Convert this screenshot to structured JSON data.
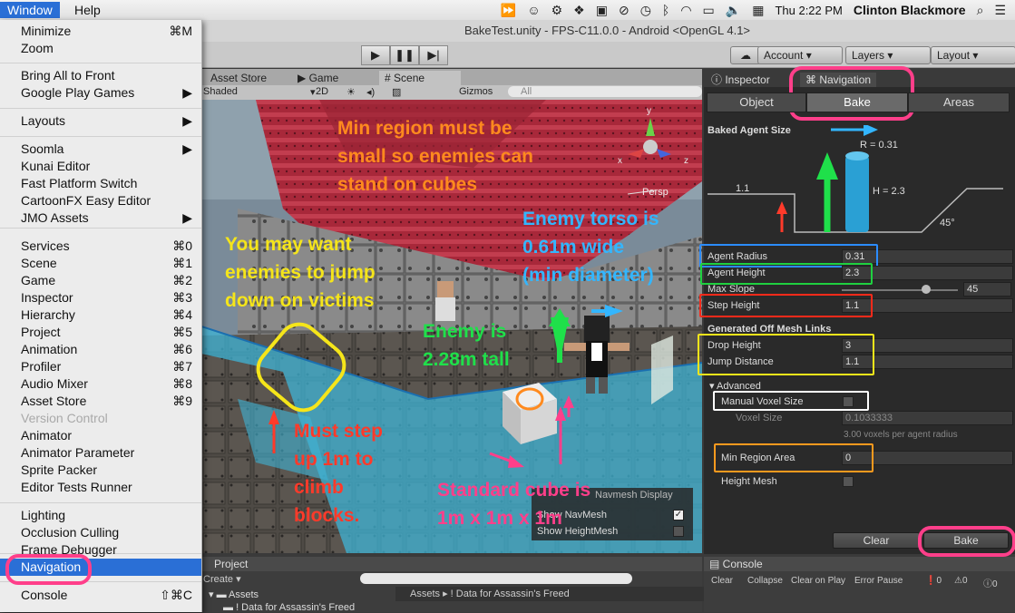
{
  "menubar": {
    "window_label": "Window",
    "help_label": "Help",
    "time": "Thu 2:22 PM",
    "user": "Clinton Blackmore"
  },
  "unity": {
    "title": "BakeTest.unity - FPS-C11.0.0 - Android <OpenGL 4.1>",
    "account": "Account",
    "layers": "Layers",
    "layout": "Layout"
  },
  "window_menu": [
    {
      "label": "Minimize",
      "shortcut": "⌘M"
    },
    {
      "label": "Zoom",
      "shortcut": ""
    },
    {
      "label": "Bring All to Front",
      "shortcut": ""
    },
    {
      "label": "Google Play Games",
      "shortcut": "▶"
    },
    {
      "label": "Layouts",
      "shortcut": "▶"
    },
    {
      "label": "Soomla",
      "shortcut": "▶"
    },
    {
      "label": "Kunai Editor",
      "shortcut": ""
    },
    {
      "label": "Fast Platform Switch",
      "shortcut": ""
    },
    {
      "label": "CartoonFX Easy Editor",
      "shortcut": ""
    },
    {
      "label": "JMO Assets",
      "shortcut": "▶"
    },
    {
      "label": "Services",
      "shortcut": "⌘0"
    },
    {
      "label": "Scene",
      "shortcut": "⌘1"
    },
    {
      "label": "Game",
      "shortcut": "⌘2"
    },
    {
      "label": "Inspector",
      "shortcut": "⌘3"
    },
    {
      "label": "Hierarchy",
      "shortcut": "⌘4"
    },
    {
      "label": "Project",
      "shortcut": "⌘5"
    },
    {
      "label": "Animation",
      "shortcut": "⌘6"
    },
    {
      "label": "Profiler",
      "shortcut": "⌘7"
    },
    {
      "label": "Audio Mixer",
      "shortcut": "⌘8"
    },
    {
      "label": "Asset Store",
      "shortcut": "⌘9"
    },
    {
      "label": "Version Control",
      "shortcut": ""
    },
    {
      "label": "Animator",
      "shortcut": ""
    },
    {
      "label": "Animator Parameter",
      "shortcut": ""
    },
    {
      "label": "Sprite Packer",
      "shortcut": ""
    },
    {
      "label": "Editor Tests Runner",
      "shortcut": ""
    },
    {
      "label": "Lighting",
      "shortcut": ""
    },
    {
      "label": "Occlusion Culling",
      "shortcut": ""
    },
    {
      "label": "Frame Debugger",
      "shortcut": ""
    },
    {
      "label": "Navigation",
      "shortcut": ""
    },
    {
      "label": "Console",
      "shortcut": "⇧⌘C"
    }
  ],
  "tabs": {
    "asset_store": "Asset Store",
    "game": "Game",
    "scene": "Scene",
    "shaded": "Shaded",
    "twod": "2D",
    "gizmos": "Gizmos",
    "search_placeholder": "All",
    "persp": "Persp",
    "project": "Project",
    "create": "Create",
    "assets": "Assets",
    "assets_path": "Assets ▸ ! Data for Assassin's Freed",
    "asset_folder": "! Data for Assassin's Freed",
    "console": "Console",
    "console_btns": [
      "Clear",
      "Collapse",
      "Clear on Play",
      "Error Pause"
    ],
    "console_counts": [
      "0",
      "0",
      "0"
    ]
  },
  "inspector": {
    "tab_inspector": "Inspector",
    "tab_navigation": "Navigation",
    "seg": [
      "Object",
      "Bake",
      "Areas"
    ],
    "baked_agent_size": "Baked Agent Size",
    "r_label": "R = 0.31",
    "h_label": "H = 2.3",
    "step_label": "1.1",
    "slope_label": "45°",
    "agent_radius": {
      "label": "Agent Radius",
      "value": "0.31"
    },
    "agent_height": {
      "label": "Agent Height",
      "value": "2.3"
    },
    "max_slope": {
      "label": "Max Slope",
      "value": "45",
      "level": 0.5
    },
    "step_height": {
      "label": "Step Height",
      "value": "1.1"
    },
    "off_mesh": "Generated Off Mesh Links",
    "drop_height": {
      "label": "Drop Height",
      "value": "3"
    },
    "jump_distance": {
      "label": "Jump Distance",
      "value": "1.1"
    },
    "advanced": "Advanced",
    "manual_voxel": "Manual Voxel Size",
    "voxel_size": {
      "label": "Voxel Size",
      "value": "0.1033333"
    },
    "voxel_note": "3.00 voxels per agent radius",
    "min_region": {
      "label": "Min Region Area",
      "value": "0"
    },
    "height_mesh": "Height Mesh",
    "clear": "Clear",
    "bake": "Bake"
  },
  "scene_overlay": {
    "show_navmesh": "Show NavMesh",
    "show_heightmesh": "Show HeightMesh",
    "nav_display": "Navmesh Display"
  },
  "annotations": {
    "min_region": "Min region must be\nsmall so enemies can\nstand on cubes",
    "jump": "You may want\nenemies to jump\ndown on victims",
    "torso": "Enemy torso is\n0.61m wide\n(min diameter)",
    "enemy_tall": "Enemy is\n2.28m tall",
    "step_up": "Must step\nup 1m to\nclimb\nblocks.",
    "cube": "Standard cube is\n1m x 1m x 1m"
  },
  "colors": {
    "orange_text": "#ff8a1e",
    "yellow_text": "#f5e51a",
    "blue_text": "#33b6ff",
    "green_text": "#1fe04a",
    "red_text": "#ff3a2a",
    "pink_text": "#ff3f8a",
    "highlight": "#2a6fd6"
  }
}
